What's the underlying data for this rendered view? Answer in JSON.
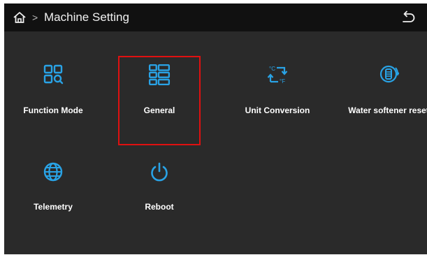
{
  "header": {
    "separator": ">",
    "title": "Machine Setting"
  },
  "tiles": [
    {
      "label": "Function Mode",
      "icon": "function-mode-icon"
    },
    {
      "label": "General",
      "icon": "general-list-icon",
      "selected": true
    },
    {
      "label": "Unit Conversion",
      "icon": "unit-conversion-icon"
    },
    {
      "label": "Water softener reset",
      "icon": "water-softener-icon"
    },
    {
      "label": "Telemetry",
      "icon": "globe-icon"
    },
    {
      "label": "Reboot",
      "icon": "power-icon"
    }
  ],
  "colors": {
    "accent": "#29a3e6",
    "background": "#2a2a2a",
    "topbar": "#111111",
    "selection": "#e01010"
  }
}
